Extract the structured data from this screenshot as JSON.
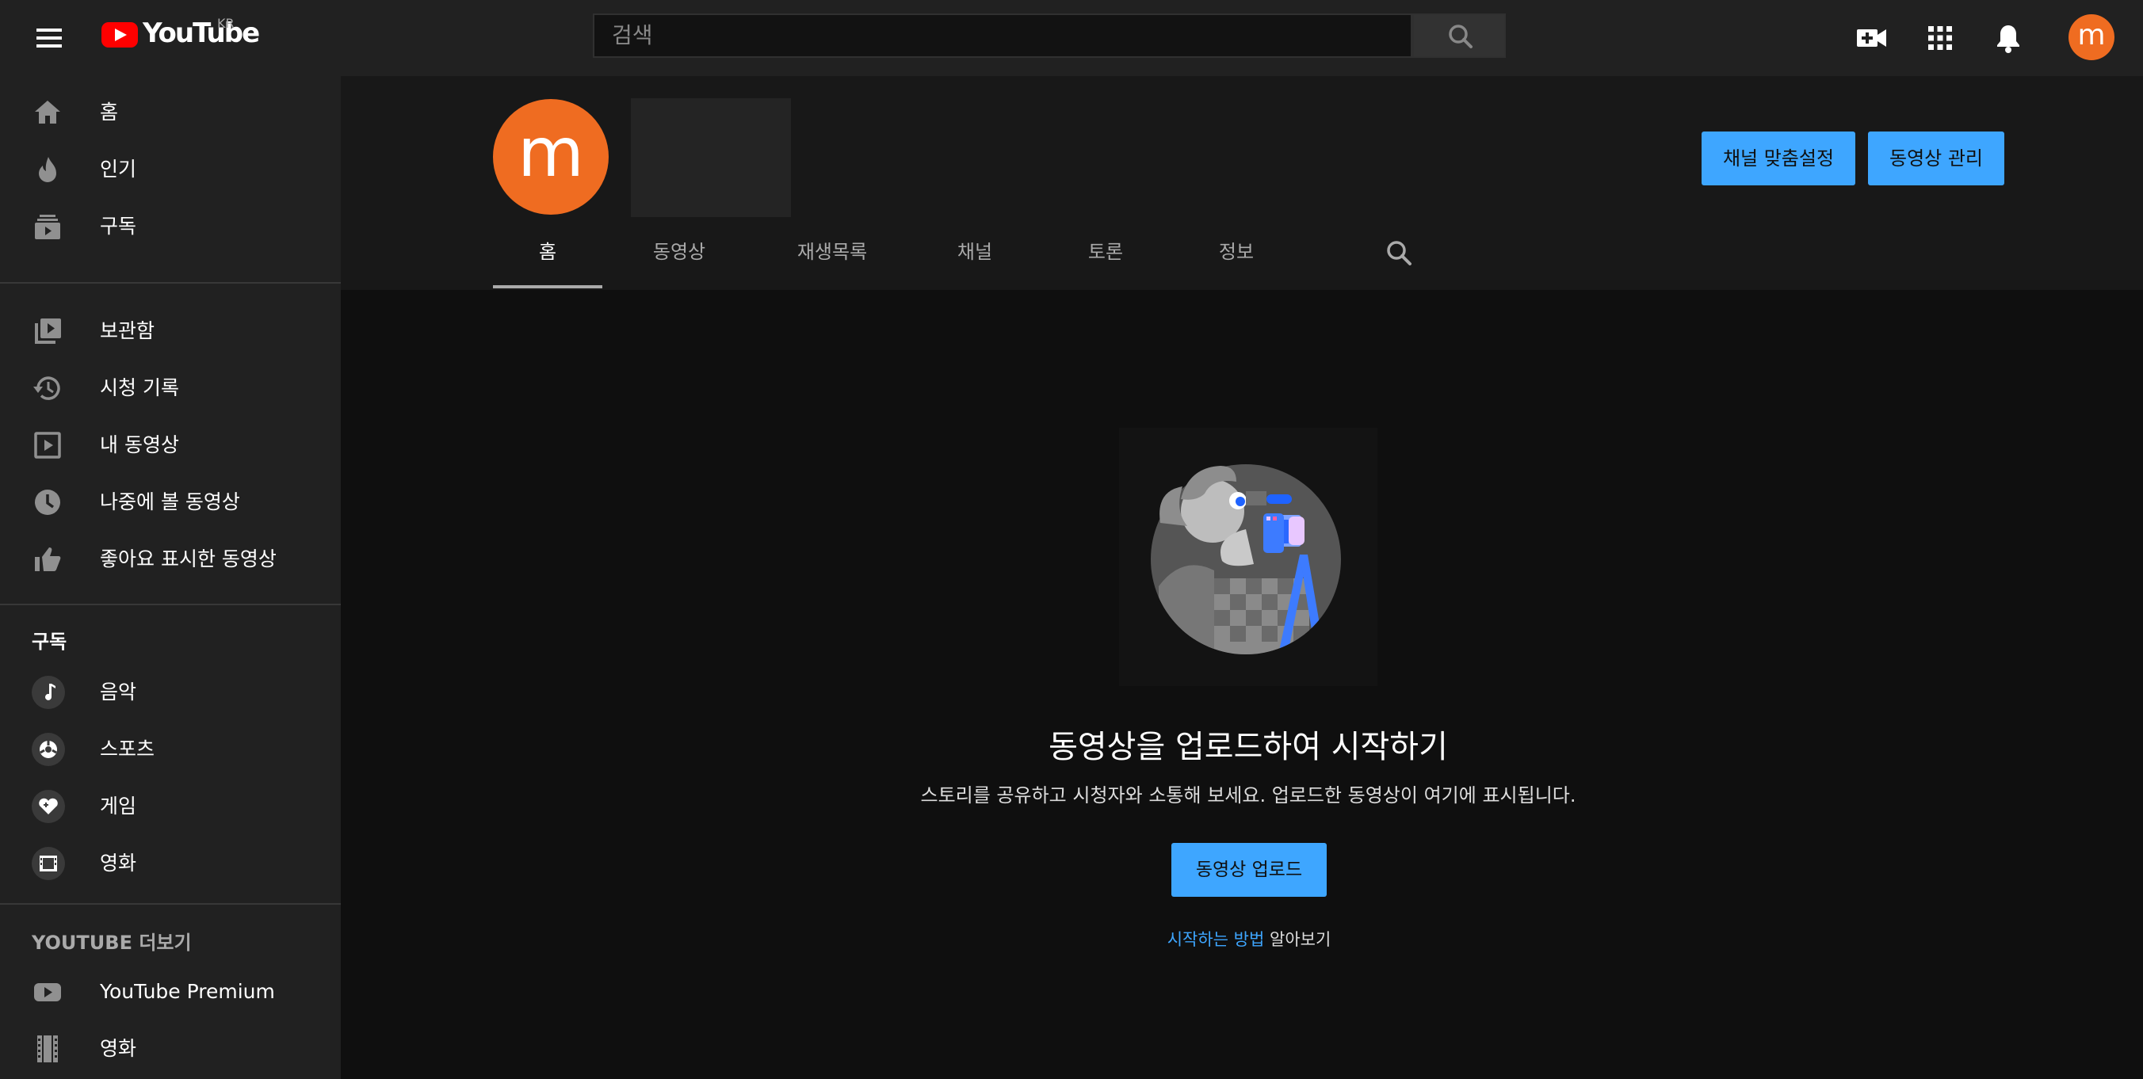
{
  "topbar": {
    "logo_text": "YouTube",
    "country_code": "KR",
    "search_placeholder": "검색",
    "avatar_letter": "m"
  },
  "sidebar": {
    "main_items": [
      {
        "label": "홈",
        "icon": "home-icon"
      },
      {
        "label": "인기",
        "icon": "fire-icon"
      },
      {
        "label": "구독",
        "icon": "subscriptions-icon"
      }
    ],
    "library_items": [
      {
        "label": "보관함",
        "icon": "library-icon"
      },
      {
        "label": "시청 기록",
        "icon": "history-icon"
      },
      {
        "label": "내 동영상",
        "icon": "my-videos-icon"
      },
      {
        "label": "나중에 볼 동영상",
        "icon": "clock-icon"
      },
      {
        "label": "좋아요 표시한 동영상",
        "icon": "thumbs-up-icon"
      }
    ],
    "subscriptions_heading": "구독",
    "subscriptions": [
      {
        "label": "음악",
        "icon": "music-icon"
      },
      {
        "label": "스포츠",
        "icon": "sports-icon"
      },
      {
        "label": "게임",
        "icon": "gaming-icon"
      },
      {
        "label": "영화",
        "icon": "film-icon"
      }
    ],
    "more_heading": "YOUTUBE 더보기",
    "more_items": [
      {
        "label": "YouTube Premium",
        "icon": "youtube-premium-icon"
      },
      {
        "label": "영화",
        "icon": "movies-icon"
      }
    ]
  },
  "channel": {
    "avatar_letter": "m",
    "customize_button": "채널 맞춤설정",
    "manage_button": "동영상 관리",
    "tabs": [
      "홈",
      "동영상",
      "재생목록",
      "채널",
      "토론",
      "정보"
    ],
    "active_tab": "홈"
  },
  "empty_state": {
    "title": "동영상을 업로드하여 시작하기",
    "description": "스토리를 공유하고 시청자와 소통해 보세요. 업로드한 동영상이 여기에 표시됩니다.",
    "upload_button": "동영상 업로드",
    "learn_link": "시작하는 방법",
    "learn_suffix": "알아보기"
  },
  "colors": {
    "accent_blue": "#3ea6ff",
    "avatar_orange": "#ef6c21",
    "logo_red": "#ff0000",
    "surface": "#212121",
    "background": "#0f0f0f"
  }
}
